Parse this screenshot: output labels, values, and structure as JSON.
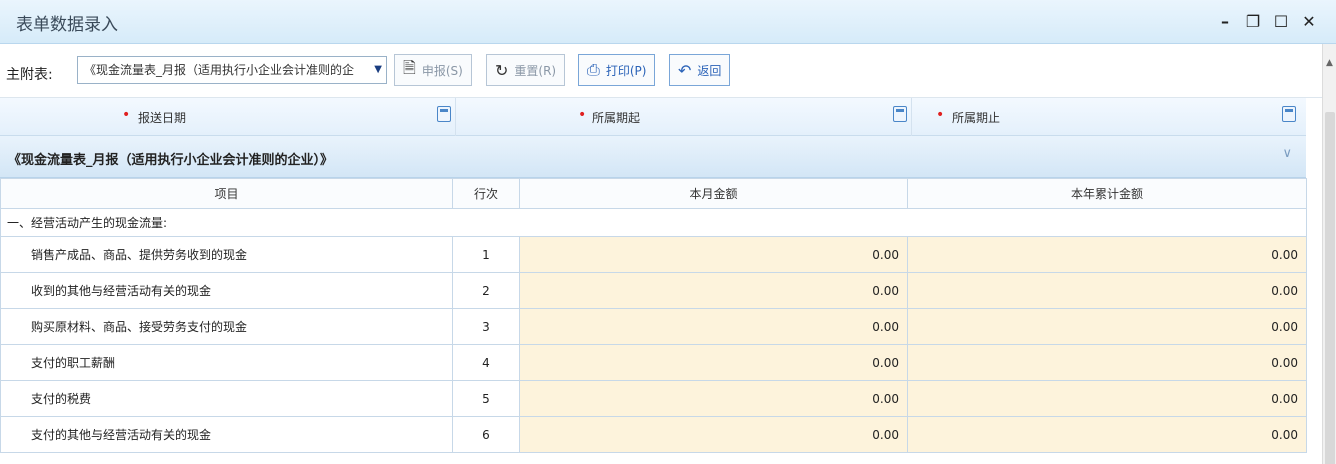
{
  "window": {
    "title": "表单数据录入",
    "controls": [
      "–",
      "❐",
      "☐",
      "✕"
    ]
  },
  "toolbar": {
    "label": "主附表:",
    "selected_report": "《现金流量表_月报（适用执行小企业会计准则的企",
    "buttons": {
      "declare": "申报(S)",
      "reset": "重置(R)",
      "print": "打印(P)",
      "back": "返回"
    }
  },
  "dates": {
    "report_date_label": "报送日期",
    "period_start_label": "所属期起",
    "period_end_label": "所属期止"
  },
  "section": {
    "title": "《现金流量表_月报（适用执行小企业会计准则的企业）》"
  },
  "table": {
    "headers": {
      "item": "项目",
      "line": "行次",
      "month_amount": "本月金额",
      "year_amount": "本年累计金额"
    },
    "group_label": "一、经营活动产生的现金流量:",
    "rows": [
      {
        "name": "销售产成品、商品、提供劳务收到的现金",
        "line": "1",
        "month": "0.00",
        "year": "0.00"
      },
      {
        "name": "收到的其他与经营活动有关的现金",
        "line": "2",
        "month": "0.00",
        "year": "0.00"
      },
      {
        "name": "购买原材料、商品、接受劳务支付的现金",
        "line": "3",
        "month": "0.00",
        "year": "0.00"
      },
      {
        "name": "支付的职工薪酬",
        "line": "4",
        "month": "0.00",
        "year": "0.00"
      },
      {
        "name": "支付的税费",
        "line": "5",
        "month": "0.00",
        "year": "0.00"
      },
      {
        "name": "支付的其他与经营活动有关的现金",
        "line": "6",
        "month": "0.00",
        "year": "0.00"
      }
    ]
  },
  "colors": {
    "amount_cell_bg": "#fdf3dc",
    "header_bg": "#d6ebf9",
    "required_dot": "#e02020"
  }
}
